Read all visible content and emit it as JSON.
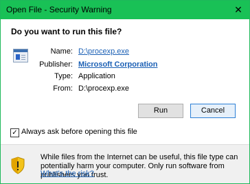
{
  "window": {
    "title": "Open File - Security Warning",
    "close_glyph": "✕"
  },
  "prompt": {
    "question": "Do you want to run this file?"
  },
  "details": {
    "name_label": "Name:",
    "name_value": "D:\\procexp.exe",
    "publisher_label": "Publisher:",
    "publisher_value": "Microsoft Corporation",
    "type_label": "Type:",
    "type_value": "Application",
    "from_label": "From:",
    "from_value": "D:\\procexp.exe"
  },
  "buttons": {
    "run_label": "Run",
    "cancel_label": "Cancel"
  },
  "checkbox": {
    "label": "Always ask before opening this file",
    "checked": true,
    "check_glyph": "✓"
  },
  "footer": {
    "warning_text": "While files from the Internet can be useful, this file type can potentially harm your computer. Only run software from publishers you trust.",
    "link_text": "What's the risk?"
  },
  "colors": {
    "titlebar": "#19c156",
    "link": "#1a5fb4",
    "shield_yellow": "#f3c31b"
  },
  "icons": {
    "file": "application-file-icon",
    "shield": "security-shield-icon",
    "close": "close-icon"
  }
}
